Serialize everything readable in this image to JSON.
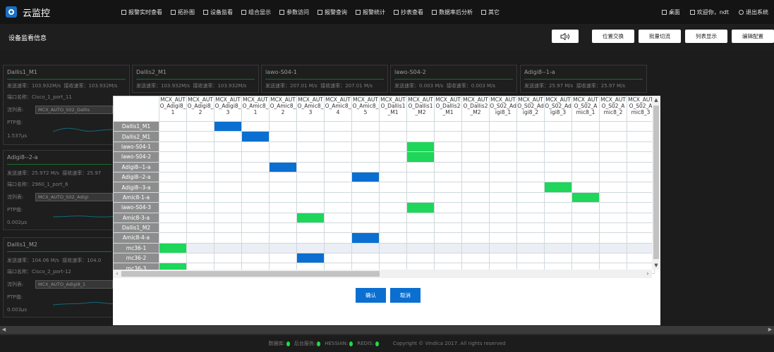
{
  "app": {
    "title": "云监控"
  },
  "nav": {
    "items": [
      "报警实时查看",
      "拓扑图",
      "设备监看",
      "组合显示",
      "参数访问",
      "报警查询",
      "报警统计",
      "抄表查看",
      "数据率后分析",
      "其它"
    ],
    "right": [
      "桌面",
      "欢迎你，ndt",
      "退出系统"
    ]
  },
  "page": {
    "title": "设备监看信息"
  },
  "toolbar": {
    "sound_icon": "speaker-icon",
    "buttons": [
      "位置交换",
      "批量切流",
      "列表显示",
      "编辑配置"
    ]
  },
  "cards": [
    {
      "name": "Dallis1_M1",
      "send": "发送速率：103.932M/s",
      "recv": "接收速率：103.932M/s",
      "port": "端口名称：Cisco_1_port_11",
      "stream_label": "流列表:",
      "stream": "MCX_AUTO_S02_Dallis",
      "ptp_label": "PTP值:",
      "ptp": "1.537μs"
    },
    {
      "name": "Dallis2_M1",
      "send": "发送速率：103.932M/s",
      "recv": "接收速率：103.932M/s"
    },
    {
      "name": "lawo-S04-1",
      "send": "发送速率：207.01  M/s",
      "recv": "接收速率：207.01  M/s"
    },
    {
      "name": "lawo-S04-2",
      "send": "发送速率：0.003  M/s",
      "recv": "接收速率：0.003  M/s"
    },
    {
      "name": "Adigi8--1-a",
      "send": "发送速率：25.97  M/s",
      "recv": "接收速率：25.97  M/s"
    },
    {
      "name": "Adigi8--2-a",
      "send": "发送速率：25.972  M/s",
      "recv": "接收速率：25.97",
      "port": "端口名称：2960_1_port_6",
      "stream_label": "流列表:",
      "stream": "MCX_AUTO_S02_Adigi",
      "ptp_label": "PTP值:",
      "ptp": "0.002μs"
    },
    {
      "name": "Dallis1_M2",
      "send": "发送速率：104.06  M/s",
      "recv": "接收速率：104.0",
      "port": "端口名称：Cisco_2_port-12",
      "stream_label": "流列表:",
      "stream": "MCX_AUTO_Adigi8_1",
      "ptp_label": "PTP值:",
      "ptp": "0.003μs"
    }
  ],
  "matrix": {
    "columns": [
      "MCX_AUTO_Adigi8_1",
      "MCX_AUTO_Adigi8_2",
      "MCX_AUTO_Adigi8_3",
      "MCX_AUTO_Amic8_1",
      "MCX_AUTO_Amic8_2",
      "MCX_AUTO_Amic8_3",
      "MCX_AUTO_Amic8_4",
      "MCX_AUTO_Amic8_5",
      "MCX_AUTO_Dallis1_M1",
      "MCX_AUTO_Dallis1_M2",
      "MCX_AUTO_Dallis2_M1",
      "MCX_AUTO_Dallis2_M2",
      "MCX_AUTO_S02_Adigi8_1",
      "MCX_AUTO_S02_Adigi8_2",
      "MCX_AUTO_S02_Adigi8_3",
      "MCX_AUTO_S02_Amic8_1",
      "MCX_AUTO_S02_Amic8_2",
      "MCX_AUTO_S02_Amic8_3"
    ],
    "rows": [
      "Dallis1_M1",
      "Dallis2_M1",
      "lawo-S04-1",
      "lawo-S04-2",
      "Adigi8--1-a",
      "Adigi8--2-a",
      "Adigi8--3-a",
      "Amic8-1-a",
      "lawo-S04-3",
      "Amic8-3-a",
      "Dallis1_M2",
      "Amic8-4-a",
      "mc36-1",
      "mc36-2",
      "mc36-3"
    ],
    "highlight_row": 12,
    "cells": [
      {
        "row": 0,
        "col": 2,
        "color": "blue"
      },
      {
        "row": 1,
        "col": 3,
        "color": "blue"
      },
      {
        "row": 2,
        "col": 9,
        "color": "green"
      },
      {
        "row": 3,
        "col": 9,
        "color": "green"
      },
      {
        "row": 4,
        "col": 4,
        "color": "blue"
      },
      {
        "row": 5,
        "col": 7,
        "color": "blue"
      },
      {
        "row": 6,
        "col": 14,
        "color": "green"
      },
      {
        "row": 7,
        "col": 15,
        "color": "green"
      },
      {
        "row": 8,
        "col": 9,
        "color": "green"
      },
      {
        "row": 9,
        "col": 5,
        "color": "green"
      },
      {
        "row": 11,
        "col": 7,
        "color": "blue"
      },
      {
        "row": 12,
        "col": 0,
        "color": "green"
      },
      {
        "row": 13,
        "col": 5,
        "color": "blue"
      },
      {
        "row": 14,
        "col": 0,
        "color": "green"
      }
    ],
    "colors": {
      "blue": "#0a6fd1",
      "green": "#1ed65a"
    }
  },
  "modal": {
    "confirm": "确认",
    "cancel": "取消"
  },
  "footer": {
    "status": [
      "数据库:",
      "后台服务:",
      "HESSIAN:",
      "REDIS:"
    ],
    "copyright": "Copyright © Vindica 2017. All rights reserved"
  }
}
